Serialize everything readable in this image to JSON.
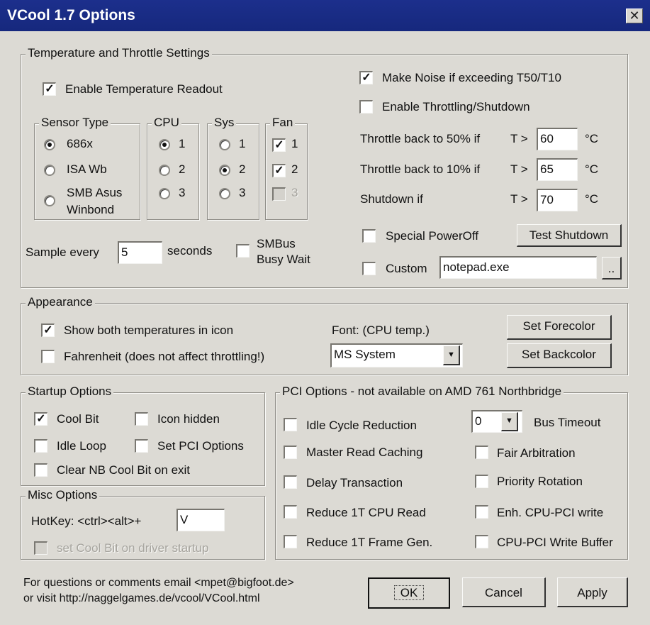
{
  "window": {
    "title": "VCool 1.7 Options",
    "close_glyph": "✕"
  },
  "temperature": {
    "legend": "Temperature and Throttle Settings",
    "enable_readout": {
      "label": "Enable Temperature Readout",
      "checked": true
    },
    "sensor_type": {
      "legend": "Sensor Type",
      "options": [
        "686x",
        "ISA Wb",
        "SMB Asus",
        "Winbond"
      ],
      "selected": "686x"
    },
    "cpu": {
      "legend": "CPU",
      "options": [
        "1",
        "2",
        "3"
      ],
      "selected": "1"
    },
    "sys": {
      "legend": "Sys",
      "options": [
        "1",
        "2",
        "3"
      ],
      "selected": "2"
    },
    "fan": {
      "legend": "Fan",
      "options": [
        "1",
        "2",
        "3"
      ],
      "checked": [
        true,
        true,
        false
      ]
    },
    "sample": {
      "label": "Sample every",
      "value": "5",
      "unit": "seconds"
    },
    "smbus": {
      "label_line1": "SMBus",
      "label_line2": "Busy Wait",
      "checked": false
    },
    "make_noise": {
      "label": "Make Noise if exceeding T50/T10",
      "checked": true
    },
    "throttling": {
      "label": "Enable Throttling/Shutdown",
      "checked": false
    },
    "throttle50": {
      "label": "Throttle back to 50% if",
      "cond": "T >",
      "value": "60",
      "unit": "°C"
    },
    "throttle10": {
      "label": "Throttle back to 10% if",
      "cond": "T >",
      "value": "65",
      "unit": "°C"
    },
    "shutdown": {
      "label": "Shutdown  if",
      "cond": "T >",
      "value": "70",
      "unit": "°C"
    },
    "special_poweroff": {
      "label": "Special PowerOff",
      "checked": false
    },
    "test_shutdown_label": "Test Shutdown",
    "custom": {
      "label": "Custom",
      "value": "notepad.exe",
      "browse_label": "..",
      "checked": false
    }
  },
  "appearance": {
    "legend": "Appearance",
    "show_both": {
      "label": "Show both temperatures in icon",
      "checked": true
    },
    "fahrenheit": {
      "label": "Fahrenheit (does not affect throttling!)",
      "checked": false
    },
    "font_label": "Font: (CPU temp.)",
    "font_value": "MS System",
    "set_forecolor": "Set Forecolor",
    "set_backcolor": "Set Backcolor"
  },
  "startup": {
    "legend": "Startup Options",
    "cool_bit": {
      "label": "Cool Bit",
      "checked": true
    },
    "icon_hidden": {
      "label": "Icon hidden",
      "checked": false
    },
    "idle_loop": {
      "label": "Idle Loop",
      "checked": false
    },
    "set_pci": {
      "label": "Set PCI Options",
      "checked": false
    },
    "clear_nb": {
      "label": "Clear NB Cool Bit on exit",
      "checked": false
    }
  },
  "misc": {
    "legend": "Misc Options",
    "hotkey_label": "HotKey: <ctrl><alt>+",
    "hotkey_value": "V",
    "set_cool_bit": {
      "label": "set Cool Bit on driver startup",
      "checked": false
    }
  },
  "pci": {
    "legend": "PCI Options - not available on AMD 761 Northbridge",
    "idle_cycle": {
      "label": "Idle Cycle Reduction",
      "checked": false
    },
    "master_read": {
      "label": "Master Read Caching",
      "checked": false
    },
    "delay_tx": {
      "label": "Delay Transaction",
      "checked": false
    },
    "reduce_read": {
      "label": "Reduce 1T CPU Read",
      "checked": false
    },
    "reduce_frame": {
      "label": "Reduce 1T Frame Gen.",
      "checked": false
    },
    "bus_timeout_value": "0",
    "bus_timeout_label": "Bus Timeout",
    "fair_arb": {
      "label": "Fair Arbitration",
      "checked": false
    },
    "priority_rot": {
      "label": "Priority Rotation",
      "checked": false
    },
    "enh_write": {
      "label": "Enh. CPU-PCI write",
      "checked": false
    },
    "write_buffer": {
      "label": "CPU-PCI Write Buffer",
      "checked": false
    }
  },
  "footer": {
    "line1": "For questions or comments email <mpet@bigfoot.de>",
    "line2": "or visit http://naggelgames.de/vcool/VCool.html",
    "ok": "OK",
    "cancel": "Cancel",
    "apply": "Apply"
  }
}
